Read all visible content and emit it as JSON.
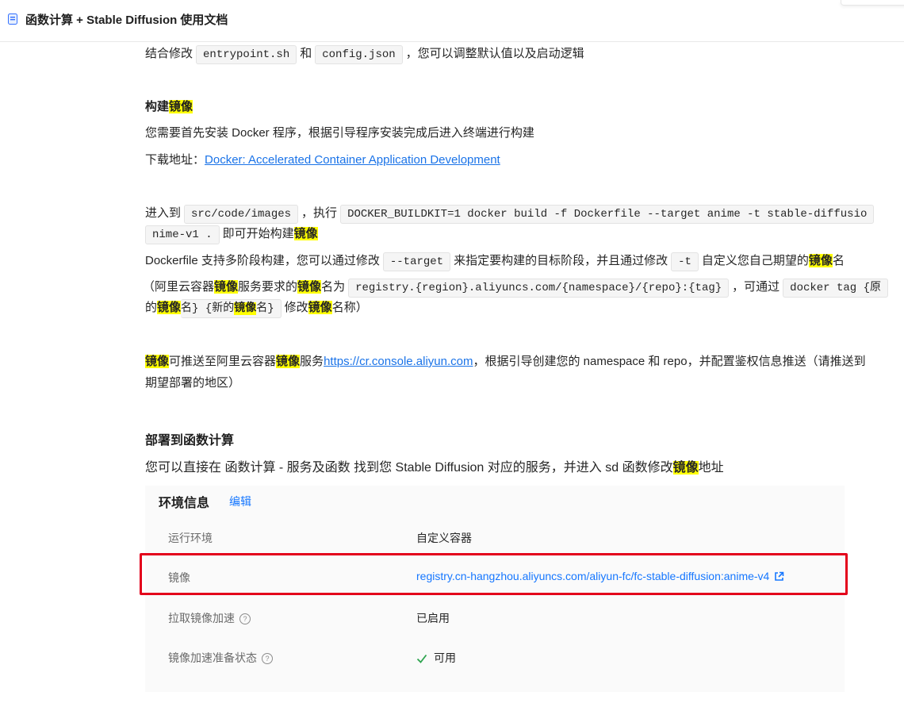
{
  "header": {
    "title": "函数计算 + Stable Diffusion 使用文档"
  },
  "paragraphs": {
    "p1": {
      "before": "结合修改",
      "code1": "entrypoint.sh",
      "mid": "和",
      "code2": "config.json",
      "after": "，您可以调整默认值以及启动逻辑"
    },
    "build_heading": {
      "text": "构建",
      "hl": "镜像"
    },
    "p2": "您需要首先安装 Docker 程序，根据引导程序安装完成后进入终端进行构建",
    "p3": {
      "label": "下载地址：",
      "link": "Docker: Accelerated Container Application Development"
    },
    "p4": {
      "before": "进入到",
      "code1": "src/code/images",
      "mid": "，执行",
      "code2": "DOCKER_BUILDKIT=1 docker build -f Dockerfile --target anime -t stable-diffusio"
    },
    "p4b": {
      "code": "nime-v1 .",
      "text": "即可开始构建",
      "hl": "镜像"
    },
    "p5": {
      "before": "Dockerfile 支持多阶段构建，您可以通过修改",
      "code1": "--target",
      "mid": "来指定要构建的目标阶段，并且通过修改",
      "code2": "-t",
      "after": "自定义您自己期望的",
      "hl": "镜像",
      "end": "名"
    },
    "p6": {
      "t1": "（阿里云容器",
      "hl1": "镜像",
      "t2": "服务要求的",
      "hl2": "镜像",
      "t3": "名为",
      "code1": "registry.{region}.aliyuncs.com/{namespace}/{repo}:{tag}",
      "t4": "，可通过",
      "code2": "docker tag {原"
    },
    "p6b": {
      "t1": "的",
      "hl1": "镜像",
      "t2": "名} {新的",
      "hl2": "镜像",
      "t3": "名}",
      "t4": "修改",
      "hl3": "镜像",
      "t5": "名称）"
    },
    "p7": {
      "hl1": "镜像",
      "t1": "可推送至阿里云容器",
      "hl2": "镜像",
      "t2": "服务",
      "link": "https://cr.console.aliyun.com",
      "t3": "，根据引导创建您的 namespace 和 repo，并配置鉴权信息推送（请推送到"
    },
    "p7b": "期望部署的地区）",
    "deploy_heading": "部署到函数计算",
    "p8": {
      "text": "您可以直接在 函数计算 - 服务及函数 找到您 Stable Diffusion 对应的服务，并进入 sd 函数修改",
      "hl": "镜像",
      "end": "地址"
    }
  },
  "env_panel": {
    "title": "环境信息",
    "edit": "编辑",
    "rows": [
      {
        "label": "运行环境",
        "value": "自定义容器"
      },
      {
        "label": "镜像",
        "value": "registry.cn-hangzhou.aliyuncs.com/aliyun-fc/fc-stable-diffusion:anime-v4"
      },
      {
        "label": "拉取镜像加速",
        "value": "已启用"
      },
      {
        "label": "镜像加速准备状态",
        "value": "可用"
      }
    ]
  },
  "colors": {
    "highlight": "#ffff00",
    "link": "#1a73e8",
    "panel_link": "#1677ff",
    "red_box": "#e3001b",
    "check": "#2ea44f"
  },
  "icons": [
    "document-icon",
    "help-icon",
    "external-link-icon",
    "check-icon"
  ]
}
